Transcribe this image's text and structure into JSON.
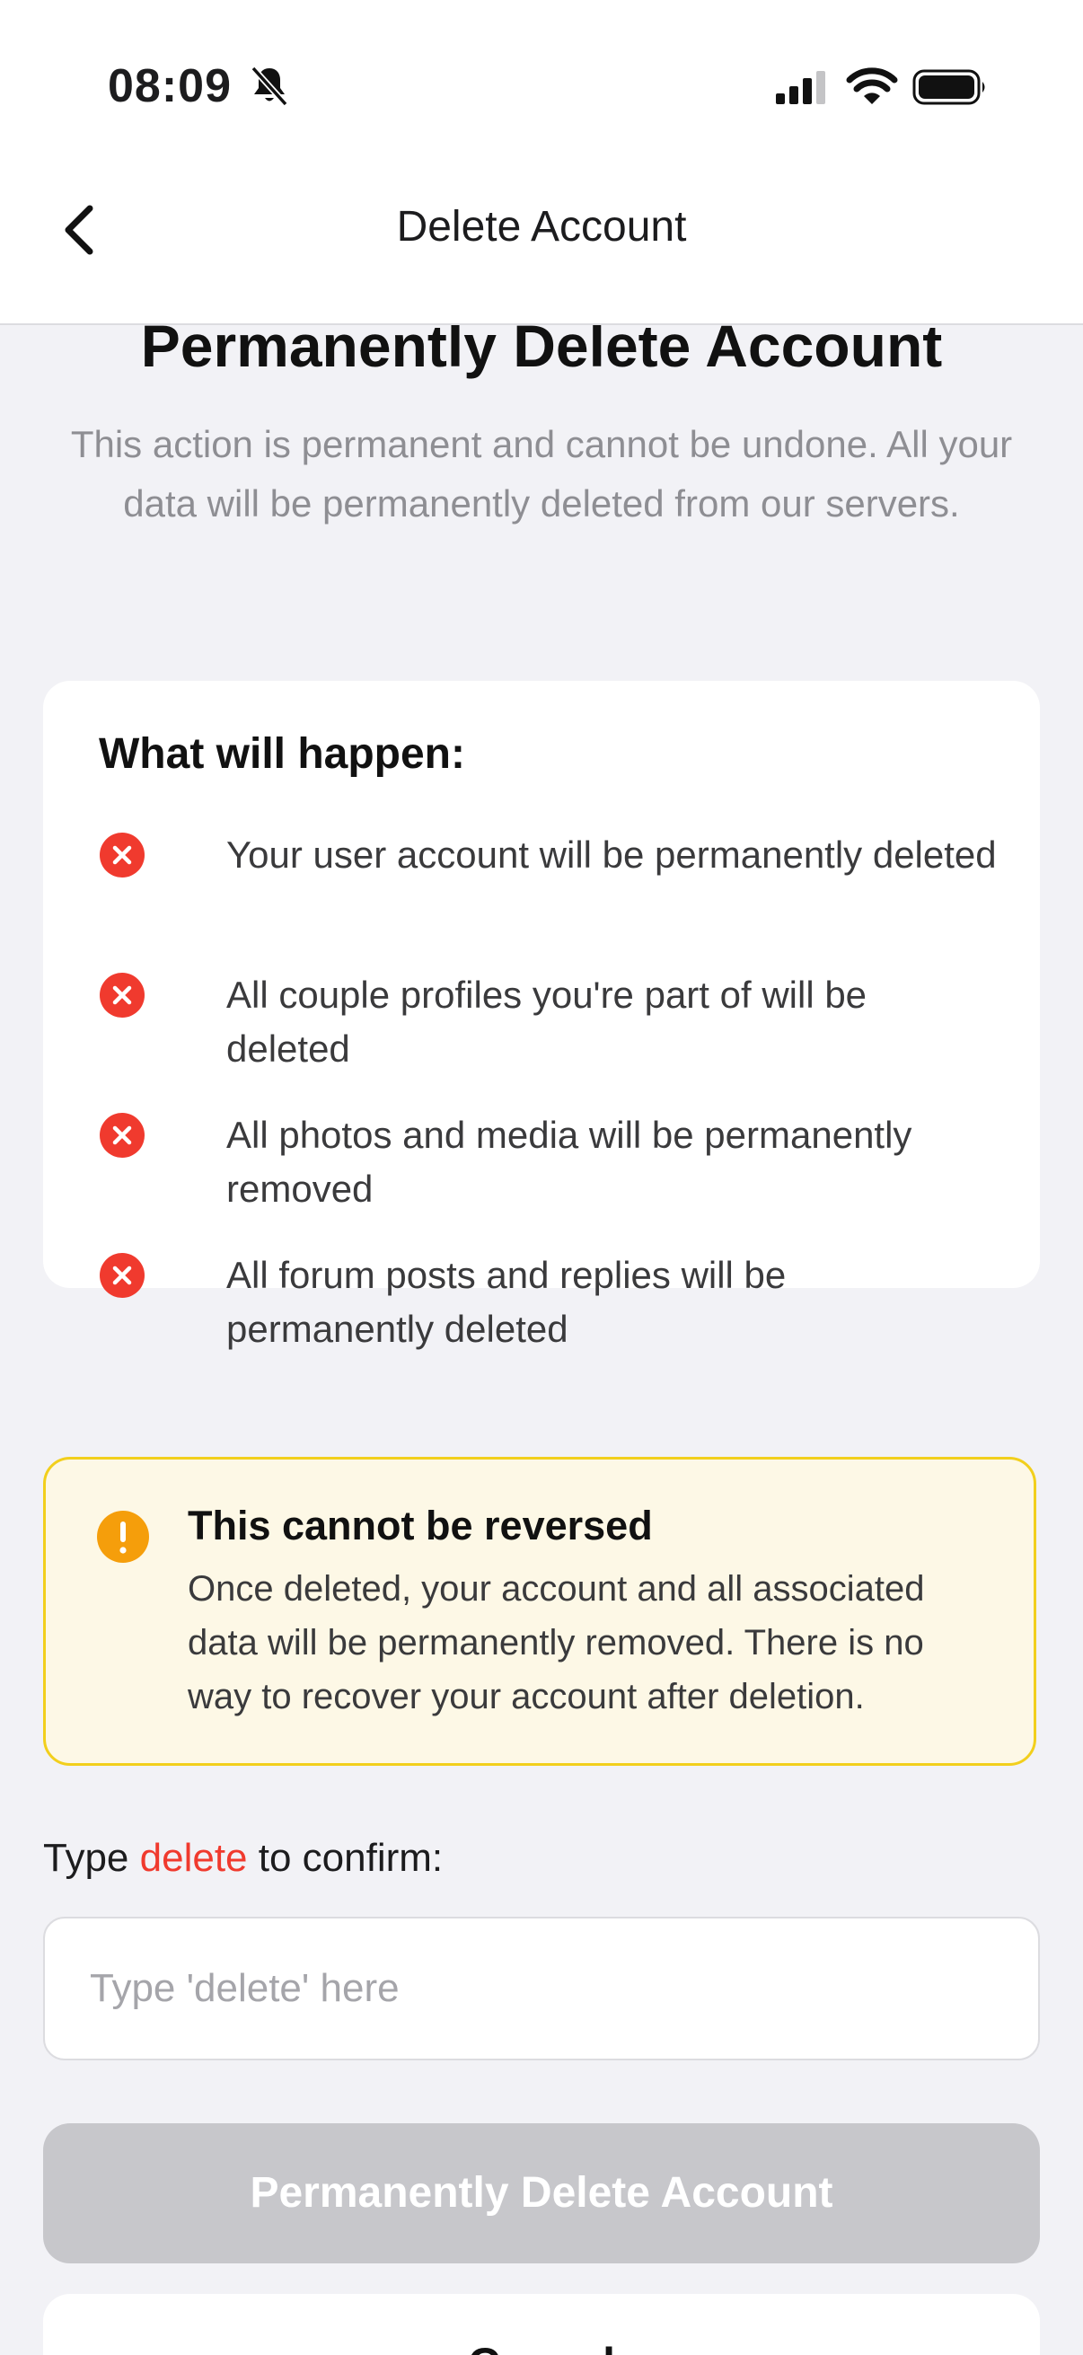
{
  "status_bar": {
    "time": "08:09",
    "icons": [
      "bell-slash-icon",
      "cellular-signal-icon",
      "wifi-icon",
      "battery-icon"
    ]
  },
  "nav": {
    "back_icon": "chevron-left-icon",
    "title": "Delete Account"
  },
  "header": {
    "title": "Permanently Delete Account",
    "subtitle": "This action is permanent and cannot be undone. All your data will be permanently deleted from our servers."
  },
  "consequences": {
    "title": "What will happen:",
    "icon": "x-circle-icon",
    "icon_color": "#f03a2e",
    "items": [
      {
        "text": "Your user account will be permanently deleted"
      },
      {
        "text": "All couple profiles you're part of will be deleted"
      },
      {
        "text": "All photos and media will be permanently removed"
      },
      {
        "text": "All forum posts and replies will be permanently deleted"
      }
    ]
  },
  "warning": {
    "icon": "exclamation-circle-icon",
    "icon_color": "#f59e0b",
    "title": "This cannot be reversed",
    "body": "Once deleted, your account and all associated data will be permanently removed. There is no way to recover your account after deletion."
  },
  "confirm": {
    "label_prefix": "Type ",
    "label_keyword": "delete",
    "label_suffix": " to confirm:",
    "keyword_color": "#f03a2e",
    "input_value": "",
    "placeholder": "Type 'delete' here"
  },
  "actions": {
    "delete_label": "Permanently Delete Account",
    "delete_state": "disabled",
    "cancel_label": "Cancel"
  },
  "colors": {
    "background": "#f2f2f6",
    "warning_bg": "#fdf8e6",
    "warning_border": "#f2cf1c",
    "disabled_button": "#c7c7cb"
  }
}
